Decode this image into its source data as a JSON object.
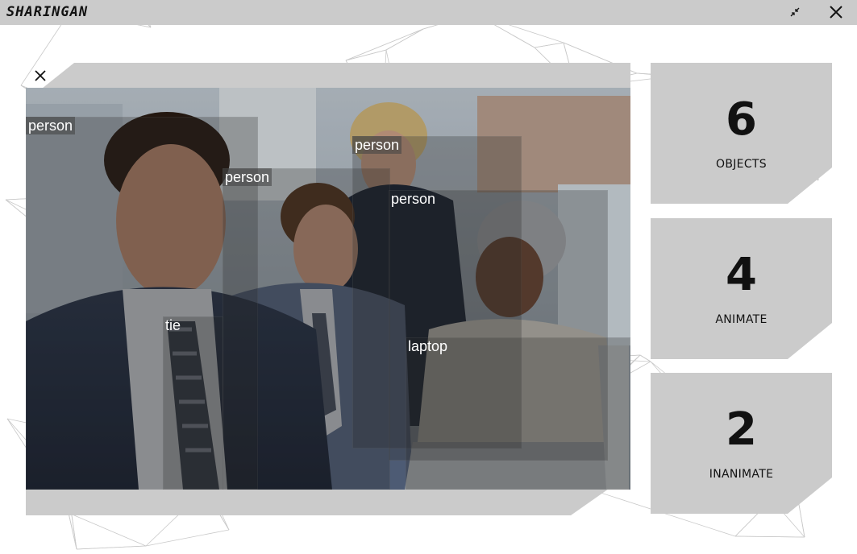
{
  "app": {
    "title": "SHARINGAN"
  },
  "window_controls": {
    "minimize_icon": "collapse-arrows-icon",
    "close_icon": "close-x-icon"
  },
  "viewer": {
    "close_icon": "close-x-icon",
    "detections": [
      {
        "label": "person"
      },
      {
        "label": "person"
      },
      {
        "label": "person"
      },
      {
        "label": "person"
      },
      {
        "label": "tie"
      },
      {
        "label": "laptop"
      }
    ]
  },
  "stats": {
    "objects": {
      "count": "6",
      "label": "OBJECTS"
    },
    "animate": {
      "count": "4",
      "label": "ANIMATE"
    },
    "inanimate": {
      "count": "2",
      "label": "INANIMATE"
    }
  }
}
